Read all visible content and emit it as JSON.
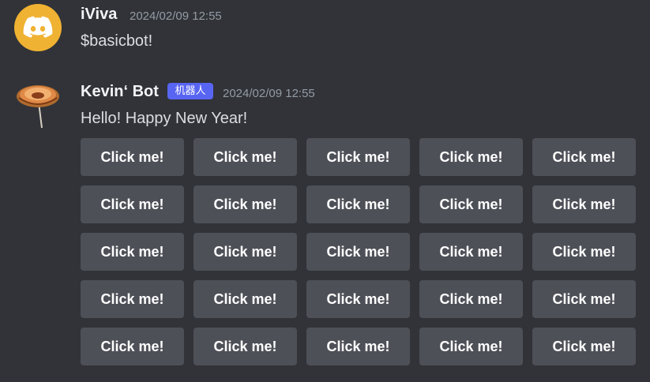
{
  "messages": [
    {
      "author": "iViva",
      "timestamp": "2024/02/09 12:55",
      "content": "$basicbot!",
      "avatar": "discord-logo-icon",
      "avatar_color": "#f0b232"
    },
    {
      "author": "Kevin‘ Bot",
      "badge": "机器人",
      "timestamp": "2024/02/09 12:55",
      "content": "Hello! Happy New Year!",
      "avatar": "flower-avatar-icon"
    }
  ],
  "colors": {
    "background": "#313338",
    "button": "#4e5058",
    "badge": "#5865f2",
    "timestamp": "#949ba4"
  },
  "buttons": [
    [
      "Click me!",
      "Click me!",
      "Click me!",
      "Click me!",
      "Click me!"
    ],
    [
      "Click me!",
      "Click me!",
      "Click me!",
      "Click me!",
      "Click me!"
    ],
    [
      "Click me!",
      "Click me!",
      "Click me!",
      "Click me!",
      "Click me!"
    ],
    [
      "Click me!",
      "Click me!",
      "Click me!",
      "Click me!",
      "Click me!"
    ],
    [
      "Click me!",
      "Click me!",
      "Click me!",
      "Click me!",
      "Click me!"
    ]
  ]
}
